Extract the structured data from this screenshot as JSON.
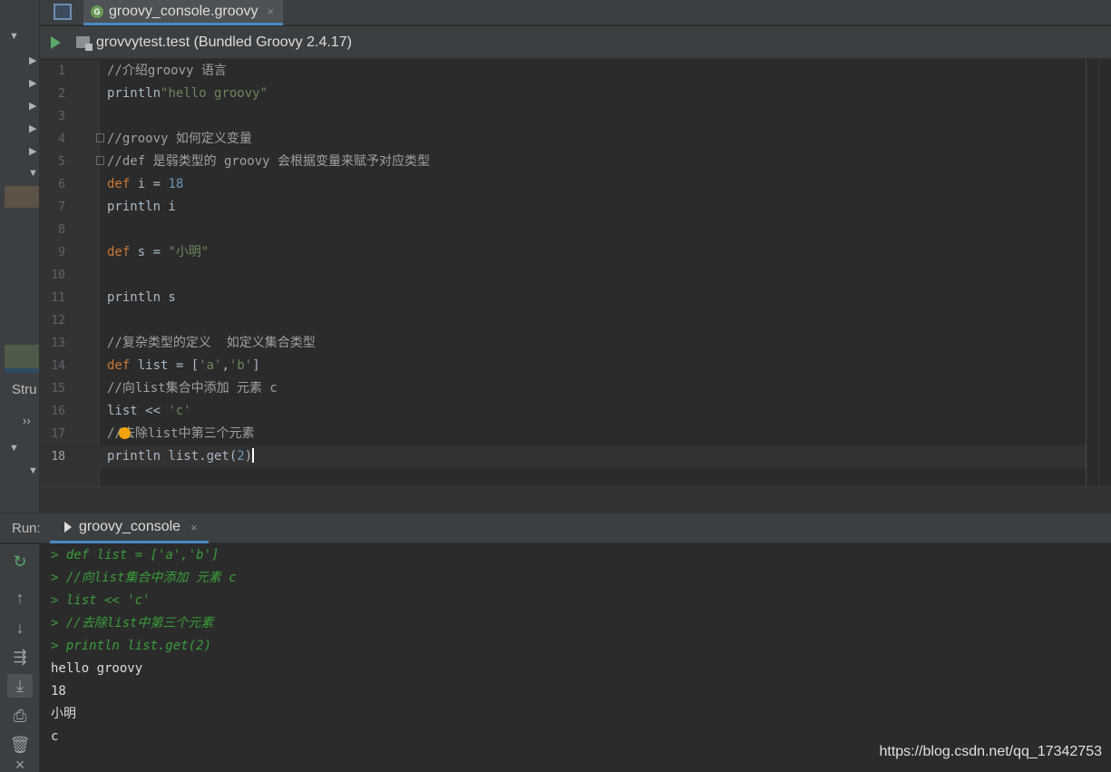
{
  "tab": {
    "label": "groovy_console.groovy",
    "close": "×",
    "icon_letter": "G"
  },
  "toolbar": {
    "config_label": "grovvytest.test (Bundled Groovy 2.4.17)"
  },
  "editor": {
    "lines": [
      {
        "n": "1",
        "html": "<span class=\"cmt\">//介绍groovy 语言</span>"
      },
      {
        "n": "2",
        "html": "println<span class=\"str\">\"hello groovy\"</span>"
      },
      {
        "n": "3",
        "html": ""
      },
      {
        "n": "4",
        "html": "<span class=\"cmt\">//groovy 如何定义变量</span>"
      },
      {
        "n": "5",
        "html": "<span class=\"cmt\">//def 是弱类型的 groovy 会根据变量来赋予对应类型</span>"
      },
      {
        "n": "6",
        "html": "<span class=\"kw\">def</span> i = <span class=\"num\">18</span>"
      },
      {
        "n": "7",
        "html": "println i"
      },
      {
        "n": "8",
        "html": ""
      },
      {
        "n": "9",
        "html": "<span class=\"kw\">def</span> s = <span class=\"str\">\"小明\"</span>"
      },
      {
        "n": "10",
        "html": ""
      },
      {
        "n": "11",
        "html": "println s"
      },
      {
        "n": "12",
        "html": ""
      },
      {
        "n": "13",
        "html": "<span class=\"cmt\">//复杂类型的定义  如定义集合类型</span>"
      },
      {
        "n": "14",
        "html": "<span class=\"kw\">def</span> list = [<span class=\"str\">'a'</span>,<span class=\"str\">'b'</span>]"
      },
      {
        "n": "15",
        "html": "<span class=\"cmt\">//向list集合中添加 元素 c</span>"
      },
      {
        "n": "16",
        "html": "list &lt;&lt; <span class=\"str\">'c'</span>"
      },
      {
        "n": "17",
        "html": "<span class=\"cmt\">//去除list中第三个元素</span>"
      },
      {
        "n": "18",
        "html": "println list.get(<span class=\"num\">2</span>)<span class=\"cursor\"></span>",
        "current": true
      }
    ]
  },
  "run_panel": {
    "title": "Run:",
    "tab_label": "groovy_console",
    "tab_close": "×",
    "console_lines": [
      {
        "text": "> def list = ['a','b']",
        "kind": "echo"
      },
      {
        "text": "> //向list集合中添加 元素 c",
        "kind": "echo"
      },
      {
        "text": "> list << 'c'",
        "kind": "echo"
      },
      {
        "text": "> //去除list中第三个元素",
        "kind": "echo"
      },
      {
        "text": "> println list.get(2)",
        "kind": "echo"
      },
      {
        "text": "hello groovy",
        "kind": "out"
      },
      {
        "text": "18",
        "kind": "out"
      },
      {
        "text": "小明",
        "kind": "out"
      },
      {
        "text": "c",
        "kind": "out"
      }
    ]
  },
  "sidebar": {
    "structure_label": "Stru",
    "more": "››"
  },
  "watermark": "https://blog.csdn.net/qq_17342753",
  "colors": {
    "keyword": "#cc7832",
    "string": "#6a8759",
    "number": "#6897bb",
    "echo": "#3a9e3a",
    "accent": "#4a88c7"
  }
}
